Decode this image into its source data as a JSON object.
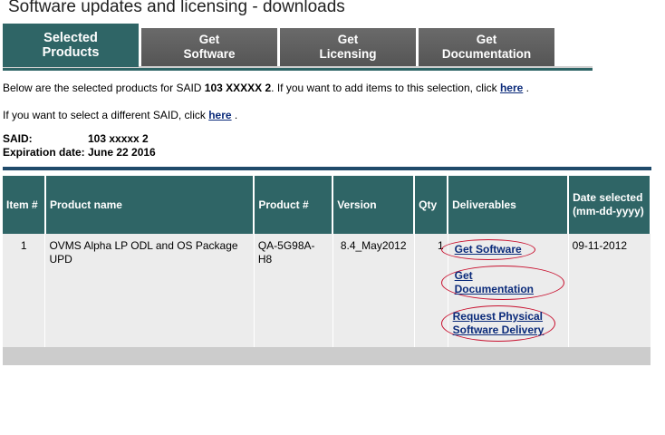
{
  "page": {
    "title": "Software updates and licensing - downloads"
  },
  "tabs": [
    {
      "line1": "Selected",
      "line2": "Products",
      "active": true
    },
    {
      "line1": "Get",
      "line2": "Software",
      "active": false
    },
    {
      "line1": "Get",
      "line2": "Licensing",
      "active": false
    },
    {
      "line1": "Get",
      "line2": "Documentation",
      "active": false
    }
  ],
  "intro": {
    "text_before": "Below are the selected products for SAID ",
    "said_bold": "103  XXXXX  2",
    "text_after": ".   If you want to add items to this selection, click ",
    "link1": "here",
    "period1": " .",
    "change_text": "If you want to select a different SAID, click ",
    "link2": "here",
    "period2": " ."
  },
  "info": {
    "said_label": "SAID:",
    "said_value": "103  xxxxx  2",
    "expiration_label": "Expiration date:",
    "expiration_value": "June 22 2016"
  },
  "table": {
    "headers": {
      "item": "Item #",
      "product_name": "Product name",
      "product_num": "Product #",
      "version": "Version",
      "qty": "Qty",
      "deliverables": "Deliverables",
      "date_line1": "Date selected",
      "date_line2": "(mm-dd-yyyy)"
    },
    "rows": [
      {
        "item": "1",
        "product_name": "OVMS Alpha LP ODL and OS Package UPD",
        "product_num": "QA-5G98A-H8",
        "version": "8.4_May2012",
        "qty": "1",
        "deliverables": {
          "get_software": "Get Software",
          "get_documentation": "Get Documentation",
          "request_line1": "Request Physical",
          "request_line2": "Software Delivery"
        },
        "date": "09-11-2012"
      }
    ]
  },
  "colors": {
    "tab_active": "#2f6566",
    "tab_inactive": "#5e5e5e",
    "header": "#2f6566",
    "highlight_circle": "#c8102e",
    "divider": "#1f4a6a"
  }
}
